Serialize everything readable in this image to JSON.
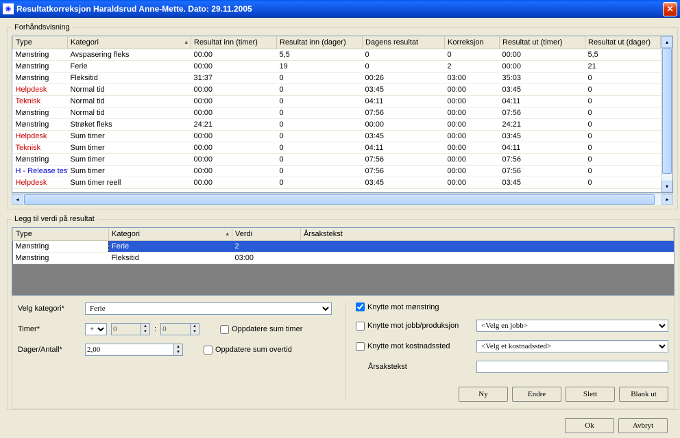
{
  "window": {
    "title": "Resultatkorreksjon  Haraldsrud Anne-Mette. Dato: 29.11.2005"
  },
  "preview": {
    "legend": "Forhåndsvisning",
    "headers": [
      "Type",
      "Kategori",
      "Resultat inn (timer)",
      "Resultat inn (dager)",
      "Dagens resultat",
      "Korreksjon",
      "Resultat ut (timer)",
      "Resultat ut (dager)"
    ],
    "rows": [
      {
        "type": "Mønstring",
        "cls": "",
        "kat": "Avspasering fleks",
        "rit": "00:00",
        "rid": "5,5",
        "dag": "0",
        "kor": "0",
        "rut": "00:00",
        "rud": "5,5"
      },
      {
        "type": "Mønstring",
        "cls": "",
        "kat": "Ferie",
        "rit": "00:00",
        "rid": "19",
        "dag": "0",
        "kor": "2",
        "rut": "00:00",
        "rud": "21"
      },
      {
        "type": "Mønstring",
        "cls": "",
        "kat": "Fleksitid",
        "rit": "31:37",
        "rid": "0",
        "dag": "00:26",
        "kor": "03:00",
        "rut": "35:03",
        "rud": "0"
      },
      {
        "type": "Helpdesk",
        "cls": "red",
        "kat": "Normal tid",
        "rit": "00:00",
        "rid": "0",
        "dag": "03:45",
        "kor": "00:00",
        "rut": "03:45",
        "rud": "0"
      },
      {
        "type": "Teknisk",
        "cls": "red",
        "kat": "Normal tid",
        "rit": "00:00",
        "rid": "0",
        "dag": "04:11",
        "kor": "00:00",
        "rut": "04:11",
        "rud": "0"
      },
      {
        "type": "Mønstring",
        "cls": "",
        "kat": "Normal tid",
        "rit": "00:00",
        "rid": "0",
        "dag": "07:56",
        "kor": "00:00",
        "rut": "07:56",
        "rud": "0"
      },
      {
        "type": "Mønstring",
        "cls": "",
        "kat": "Strøket fleks",
        "rit": "24:21",
        "rid": "0",
        "dag": "00:00",
        "kor": "00:00",
        "rut": "24:21",
        "rud": "0"
      },
      {
        "type": "Helpdesk",
        "cls": "red",
        "kat": "Sum timer",
        "rit": "00:00",
        "rid": "0",
        "dag": "03:45",
        "kor": "00:00",
        "rut": "03:45",
        "rud": "0"
      },
      {
        "type": "Teknisk",
        "cls": "red",
        "kat": "Sum timer",
        "rit": "00:00",
        "rid": "0",
        "dag": "04:11",
        "kor": "00:00",
        "rut": "04:11",
        "rud": "0"
      },
      {
        "type": "Mønstring",
        "cls": "",
        "kat": "Sum timer",
        "rit": "00:00",
        "rid": "0",
        "dag": "07:56",
        "kor": "00:00",
        "rut": "07:56",
        "rud": "0"
      },
      {
        "type": "H - Release test",
        "cls": "blue",
        "kat": "Sum timer",
        "rit": "00:00",
        "rid": "0",
        "dag": "07:56",
        "kor": "00:00",
        "rut": "07:56",
        "rud": "0"
      },
      {
        "type": "Helpdesk",
        "cls": "red",
        "kat": "Sum timer reell",
        "rit": "00:00",
        "rid": "0",
        "dag": "03:45",
        "kor": "00:00",
        "rut": "03:45",
        "rud": "0"
      }
    ]
  },
  "add": {
    "legend": "Legg til verdi på resultat",
    "headers": [
      "Type",
      "Kategori",
      "Verdi",
      "Årsakstekst"
    ],
    "rows": [
      {
        "sel": true,
        "type": "Mønstring",
        "kat": "Ferie",
        "verdi": "2",
        "tekst": ""
      },
      {
        "sel": false,
        "type": "Mønstring",
        "kat": "Fleksitid",
        "verdi": "03:00",
        "tekst": ""
      }
    ]
  },
  "form": {
    "velg_kategori_label": "Velg kategori*",
    "velg_kategori_value": "Ferie",
    "timer_label": "Timer*",
    "timer_sign": "+",
    "timer_h": "0",
    "timer_m": "0",
    "oppdatere_sum_timer": "Oppdatere sum timer",
    "dager_label": "Dager/Antall*",
    "dager_value": "2,00",
    "oppdatere_sum_overtid": "Oppdatere sum overtid",
    "knytte_monstring": "Knytte mot mønstring",
    "knytte_jobb": "Knytte mot jobb/produksjon",
    "jobb_value": "<Velg en jobb>",
    "knytte_kostnad": "Knytte mot kostnadssted",
    "kostnad_value": "<Velg et kostnadssted>",
    "arsak_label": "Årsakstekst",
    "arsak_value": ""
  },
  "buttons": {
    "ny": "Ny",
    "endre": "Endre",
    "slett": "Slett",
    "blank": "Blank ut",
    "ok": "Ok",
    "avbryt": "Avbryt"
  }
}
